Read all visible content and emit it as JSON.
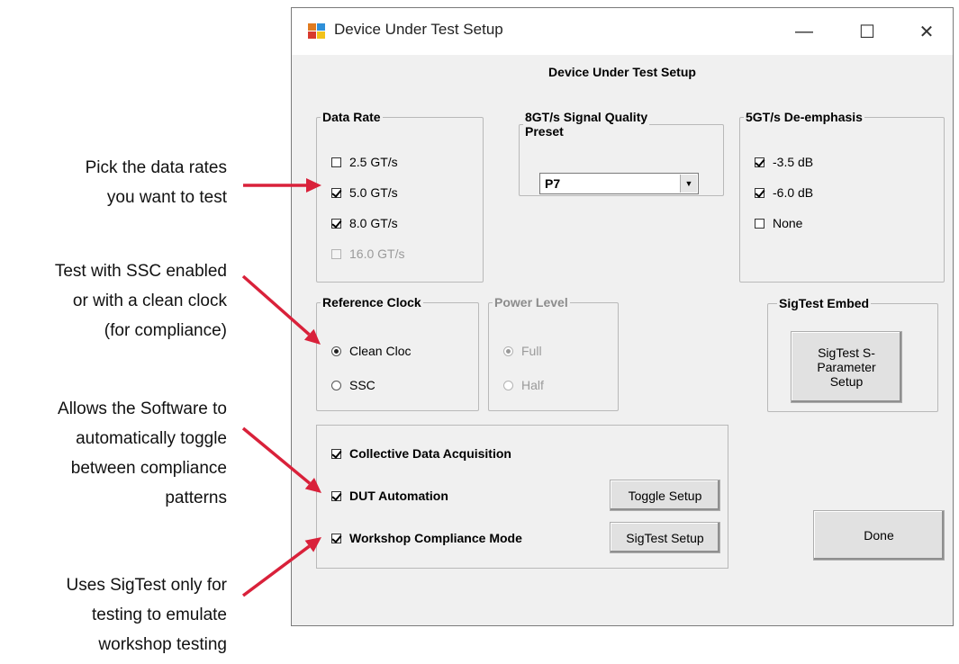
{
  "annotations": [
    {
      "lines": [
        "Pick the data rates",
        "you want to test"
      ]
    },
    {
      "lines": [
        "Test with SSC enabled",
        "or with a clean clock",
        "(for compliance)"
      ]
    },
    {
      "lines": [
        "Allows the Software to",
        "automatically toggle",
        "between compliance",
        "patterns"
      ]
    },
    {
      "lines": [
        "Uses SigTest only for",
        "testing to emulate",
        "workshop testing"
      ]
    }
  ],
  "colors": {
    "arrow": "#d9213a"
  },
  "window": {
    "title": "Device Under Test Setup",
    "controls": {
      "minimize": "—",
      "maximize": "☐",
      "close": "✕"
    }
  },
  "dialog": {
    "heading": "Device Under Test Setup",
    "data_rate": {
      "legend": "Data Rate",
      "items": [
        {
          "label": "2.5 GT/s",
          "checked": false,
          "enabled": true
        },
        {
          "label": "5.0 GT/s",
          "checked": true,
          "enabled": true
        },
        {
          "label": "8.0 GT/s",
          "checked": true,
          "enabled": true
        },
        {
          "label": "16.0 GT/s",
          "checked": false,
          "enabled": false
        }
      ]
    },
    "preset": {
      "legend_line1": "8GT/s Signal Quality",
      "legend_line2": "Preset",
      "value": "P7"
    },
    "deemphasis": {
      "legend": "5GT/s De-emphasis",
      "items": [
        {
          "label": "-3.5 dB",
          "checked": true
        },
        {
          "label": "-6.0 dB",
          "checked": true
        },
        {
          "label": "None",
          "checked": false
        }
      ]
    },
    "ref_clock": {
      "legend": "Reference Clock",
      "options": [
        {
          "label": "Clean Cloc",
          "selected": true
        },
        {
          "label": "SSC",
          "selected": false
        }
      ]
    },
    "power_level": {
      "legend": "Power Level",
      "options": [
        {
          "label": "Full",
          "selected": true
        },
        {
          "label": "Half",
          "selected": false
        }
      ]
    },
    "sigtest_embed": {
      "legend": "SigTest Embed",
      "button_line1": "SigTest S-",
      "button_line2": "Parameter",
      "button_line3": "Setup"
    },
    "options": {
      "collective": {
        "label": "Collective Data Acquisition",
        "checked": true
      },
      "dut_automation": {
        "label": "DUT Automation",
        "checked": true
      },
      "workshop_mode": {
        "label": "Workshop Compliance Mode",
        "checked": true
      }
    },
    "buttons": {
      "toggle_setup": "Toggle Setup",
      "sigtest_setup": "SigTest Setup",
      "done": "Done"
    }
  }
}
